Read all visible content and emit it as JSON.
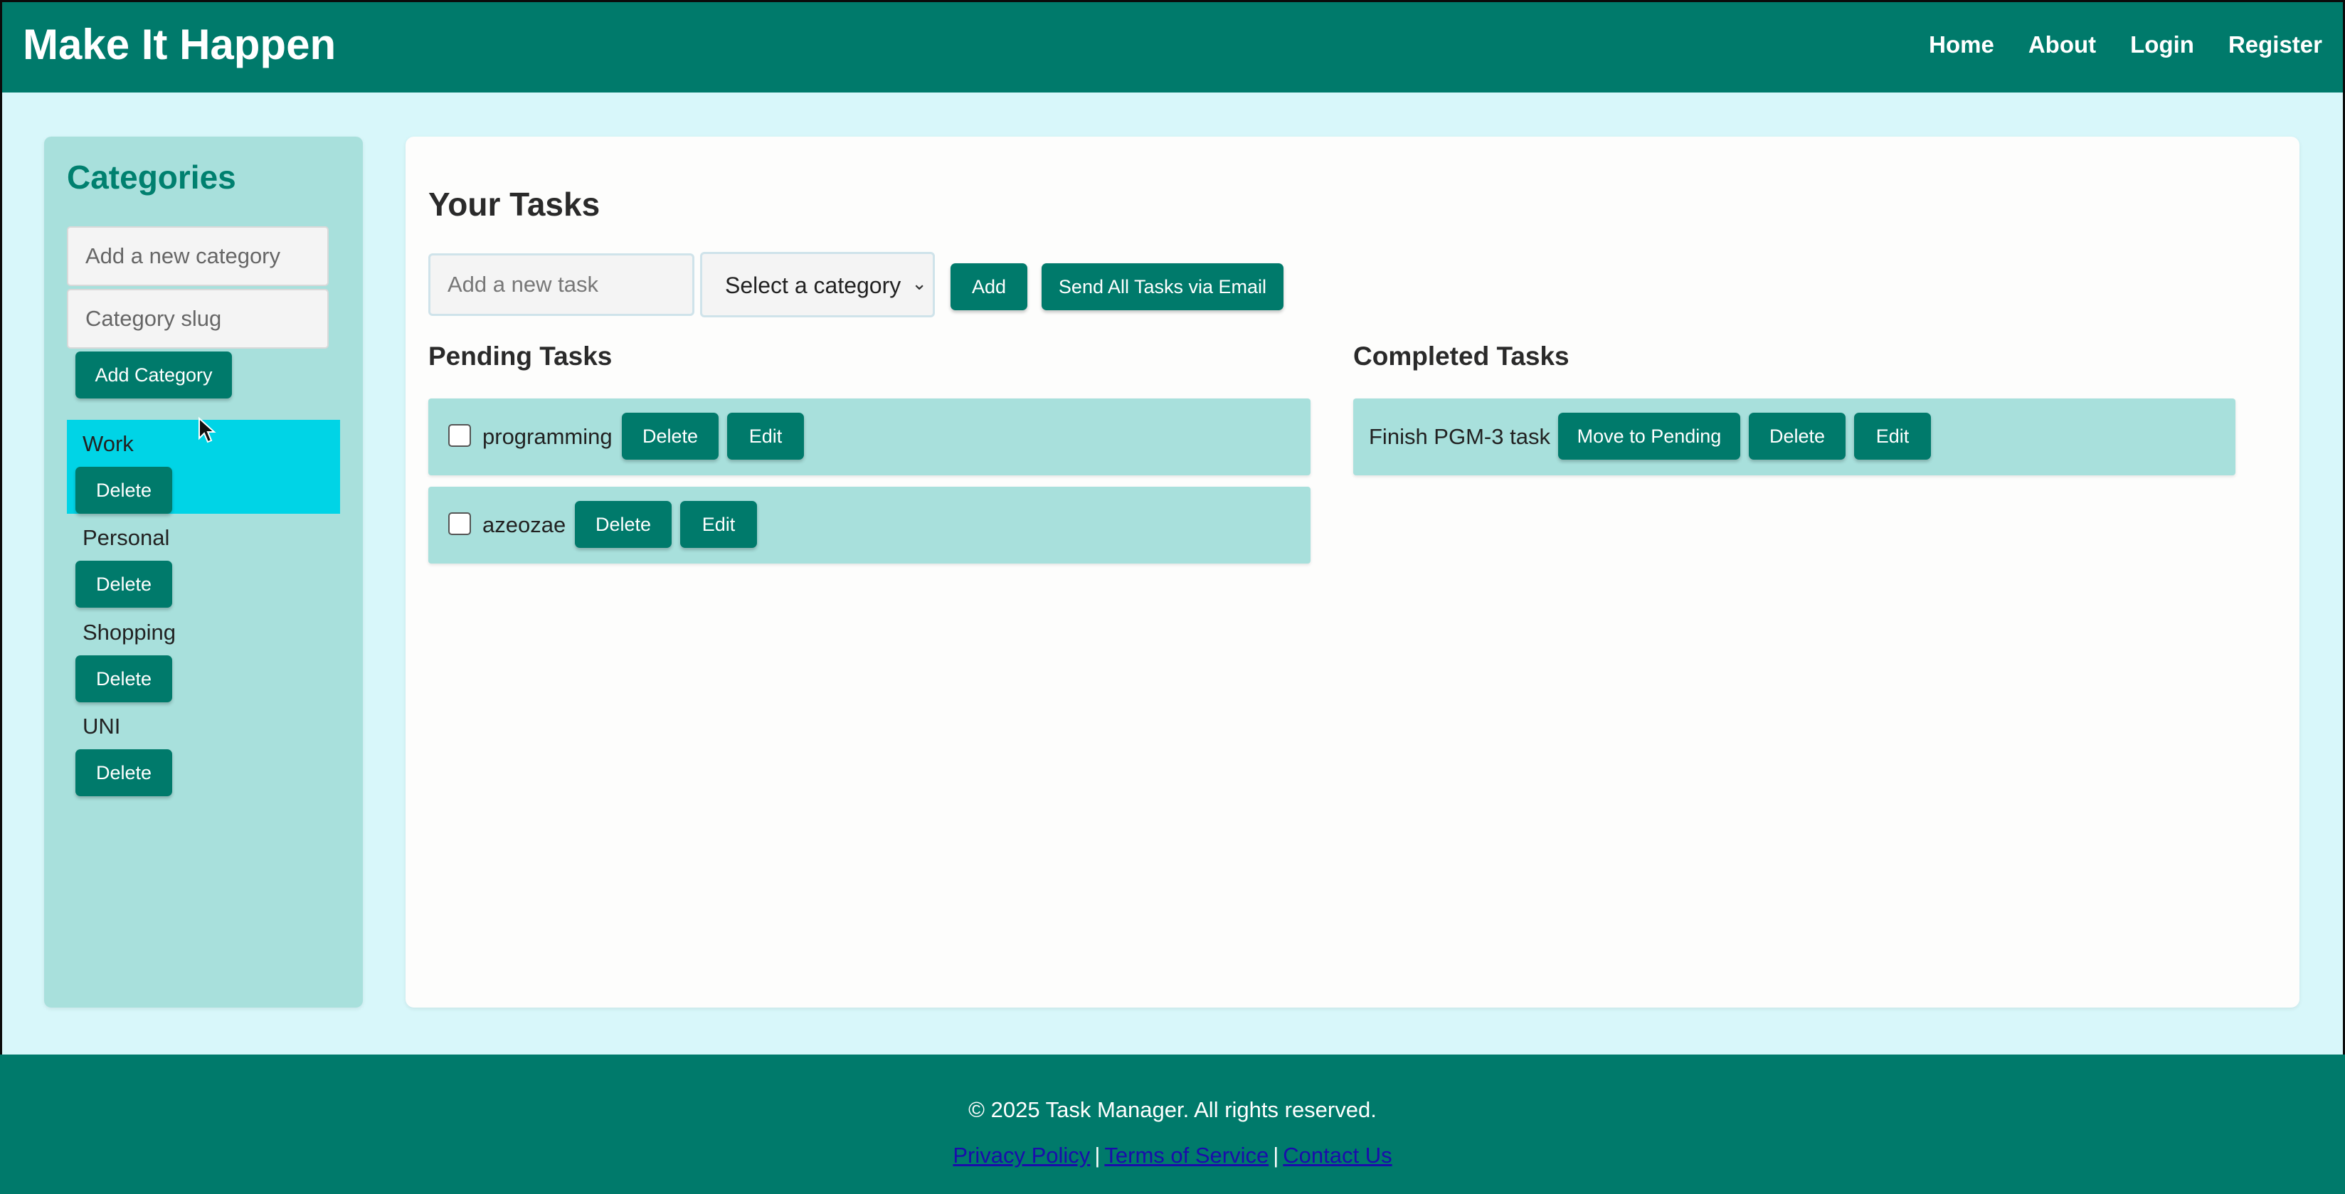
{
  "header": {
    "brand": "Make It Happen",
    "nav": [
      "Home",
      "About",
      "Login",
      "Register"
    ]
  },
  "sidebar": {
    "title": "Categories",
    "new_category_placeholder": "Add a new category",
    "slug_placeholder": "Category slug",
    "add_button": "Add Category",
    "delete_label": "Delete",
    "categories": [
      {
        "label": "Work",
        "active": true
      },
      {
        "label": "Personal",
        "active": false
      },
      {
        "label": "Shopping",
        "active": false
      },
      {
        "label": "UNI",
        "active": false
      }
    ]
  },
  "main": {
    "title": "Your Tasks",
    "task_placeholder": "Add a new task",
    "category_select": "Select a category",
    "add_button": "Add",
    "email_button": "Send All Tasks via Email",
    "pending_title": "Pending Tasks",
    "completed_title": "Completed Tasks",
    "pending_tasks": [
      {
        "name": "programming",
        "checked": false
      },
      {
        "name": "azeozae",
        "checked": false
      }
    ],
    "completed_tasks": [
      {
        "name": "Finish PGM-3 task"
      }
    ],
    "delete_label": "Delete",
    "edit_label": "Edit",
    "move_label": "Move to Pending"
  },
  "footer": {
    "copyright": "© 2025 Task Manager. All rights reserved.",
    "links": [
      "Privacy Policy",
      "Terms of Service",
      "Contact Us"
    ],
    "separator": "|"
  },
  "colors": {
    "primary": "#007a6b",
    "background": "#d8f7fa",
    "sidebar": "#a8e0dc",
    "active_category": "#00d4e6"
  }
}
